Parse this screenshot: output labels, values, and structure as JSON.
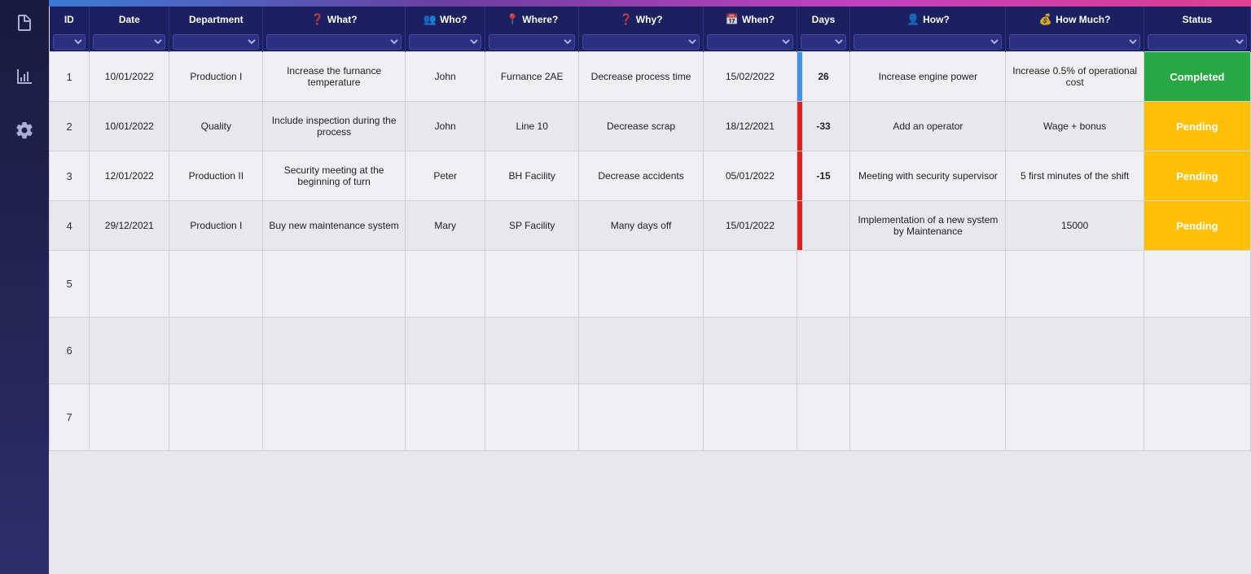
{
  "sidebar": {
    "icons": [
      {
        "name": "document-icon",
        "symbol": "📋"
      },
      {
        "name": "chart-icon",
        "symbol": "📊"
      },
      {
        "name": "settings-icon",
        "symbol": "⚙"
      }
    ]
  },
  "table": {
    "headers": [
      {
        "key": "id",
        "label": "ID",
        "icon": ""
      },
      {
        "key": "date",
        "label": "Date",
        "icon": ""
      },
      {
        "key": "department",
        "label": "Department",
        "icon": ""
      },
      {
        "key": "what",
        "label": "What?",
        "icon": "?"
      },
      {
        "key": "who",
        "label": "Who?",
        "icon": "👥"
      },
      {
        "key": "where",
        "label": "Where?",
        "icon": "📍"
      },
      {
        "key": "why",
        "label": "Why?",
        "icon": "?"
      },
      {
        "key": "when",
        "label": "When?",
        "icon": "📅"
      },
      {
        "key": "days",
        "label": "Days",
        "icon": ""
      },
      {
        "key": "how",
        "label": "How?",
        "icon": "👤"
      },
      {
        "key": "howmuch",
        "label": "How Much?",
        "icon": "💰"
      },
      {
        "key": "status",
        "label": "Status",
        "icon": ""
      }
    ],
    "rows": [
      {
        "id": "1",
        "date": "10/01/2022",
        "department": "Production I",
        "what": "Increase the furnance temperature",
        "who": "John",
        "where": "Furnance 2AE",
        "why": "Decrease process time",
        "when": "15/02/2022",
        "days": "26",
        "days_color": "#4a90e2",
        "how": "Increase engine power",
        "howmuch": "Increase 0.5% of operational cost",
        "status": "Completed",
        "status_type": "completed"
      },
      {
        "id": "2",
        "date": "10/01/2022",
        "department": "Quality",
        "what": "Include inspection during the process",
        "who": "John",
        "where": "Line 10",
        "why": "Decrease scrap",
        "when": "18/12/2021",
        "days": "-33",
        "days_color": "#e02020",
        "how": "Add an operator",
        "howmuch": "Wage + bonus",
        "status": "Pending",
        "status_type": "pending"
      },
      {
        "id": "3",
        "date": "12/01/2022",
        "department": "Production II",
        "what": "Security meeting at the beginning of turn",
        "who": "Peter",
        "where": "BH Facility",
        "why": "Decrease accidents",
        "when": "05/01/2022",
        "days": "-15",
        "days_color": "#e02020",
        "how": "Meeting with security supervisor",
        "howmuch": "5 first minutes of the shift",
        "status": "Pending",
        "status_type": "pending"
      },
      {
        "id": "4",
        "date": "29/12/2021",
        "department": "Production I",
        "what": "Buy new maintenance system",
        "who": "Mary",
        "where": "SP Facility",
        "why": "Many days off",
        "when": "15/01/2022",
        "days": "",
        "days_color": "#e02020",
        "how": "Implementation of a new system by Maintenance",
        "howmuch": "15000",
        "status": "Pending",
        "status_type": "pending"
      }
    ],
    "empty_rows": [
      "5",
      "6",
      "7"
    ]
  }
}
